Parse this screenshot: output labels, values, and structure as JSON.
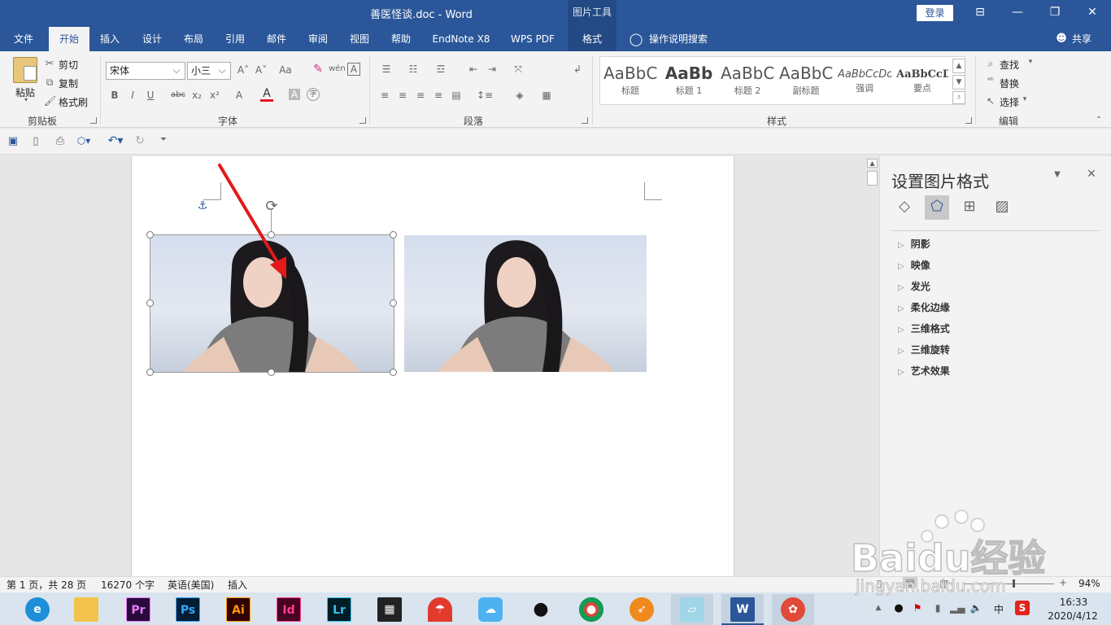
{
  "title_bar": {
    "document_title": "善医怪谈.doc  -  Word",
    "context_tab_group": "图片工具",
    "login_label": "登录",
    "restore_ribbon_icon": "ribbon-display-icon",
    "minimize": "—",
    "maximize": "❐",
    "close": "✕"
  },
  "tabs": [
    {
      "label": "文件"
    },
    {
      "label": "开始"
    },
    {
      "label": "插入"
    },
    {
      "label": "设计"
    },
    {
      "label": "布局"
    },
    {
      "label": "引用"
    },
    {
      "label": "邮件"
    },
    {
      "label": "审阅"
    },
    {
      "label": "视图"
    },
    {
      "label": "帮助"
    },
    {
      "label": "EndNote X8"
    },
    {
      "label": "WPS PDF"
    },
    {
      "label": "格式"
    }
  ],
  "tell_me": "操作说明搜索",
  "share_label": "共享",
  "ribbon": {
    "clipboard": {
      "group_label": "剪贴板",
      "paste": "粘贴",
      "cut": "剪切",
      "copy": "复制",
      "format_painter": "格式刷"
    },
    "font": {
      "group_label": "字体",
      "font_name": "宋体",
      "font_size": "小三",
      "bold": "B",
      "italic": "I",
      "underline": "U",
      "strike": "abc",
      "subscript": "x₂",
      "superscript": "x²",
      "change_case": "Aa",
      "grow": "A˄",
      "shrink": "A˅",
      "wen": "wén",
      "char_border": "A",
      "font_color": "A",
      "font_color_value": "#e81123",
      "char_shade": "A",
      "enclose": "字"
    },
    "paragraph": {
      "group_label": "段落"
    },
    "styles": {
      "group_label": "样式",
      "items": [
        {
          "sample": "AaBbC",
          "name": "标题"
        },
        {
          "sample": "AaBb",
          "name": "标题 1"
        },
        {
          "sample": "AaBbC",
          "name": "标题 2"
        },
        {
          "sample": "AaBbC",
          "name": "副标题"
        },
        {
          "sample": "AaBbCcDd",
          "name": "强调"
        },
        {
          "sample": "AaBbCcD",
          "name": "要点"
        }
      ]
    },
    "editing": {
      "group_label": "编辑",
      "find": "查找",
      "replace": "替换",
      "select": "选择"
    }
  },
  "format_pane": {
    "title": "设置图片格式",
    "sections": [
      {
        "label": "阴影"
      },
      {
        "label": "映像"
      },
      {
        "label": "发光"
      },
      {
        "label": "柔化边缘"
      },
      {
        "label": "三维格式"
      },
      {
        "label": "三维旋转"
      },
      {
        "label": "艺术效果"
      }
    ]
  },
  "status_bar": {
    "page": "第 1 页，共 28 页",
    "words": "16270 个字",
    "language": "英语(美国)",
    "mode": "插入",
    "zoom": "94%"
  },
  "taskbar": {
    "apps": [
      {
        "label": "Pr",
        "color": "#2a0a3d",
        "fg": "#e87cf4"
      },
      {
        "label": "Ps",
        "color": "#001d34",
        "fg": "#31a8ff"
      },
      {
        "label": "Ai",
        "color": "#330000",
        "fg": "#ff9a00"
      },
      {
        "label": "Id",
        "color": "#49021f",
        "fg": "#ff3f94"
      },
      {
        "label": "Lr",
        "color": "#001d26",
        "fg": "#31c5f0"
      }
    ],
    "time": "16:33",
    "date": "2020/4/12",
    "ime": "中"
  },
  "watermark": {
    "brand": "Baidu经验",
    "url": "jingyan.baidu.com"
  }
}
